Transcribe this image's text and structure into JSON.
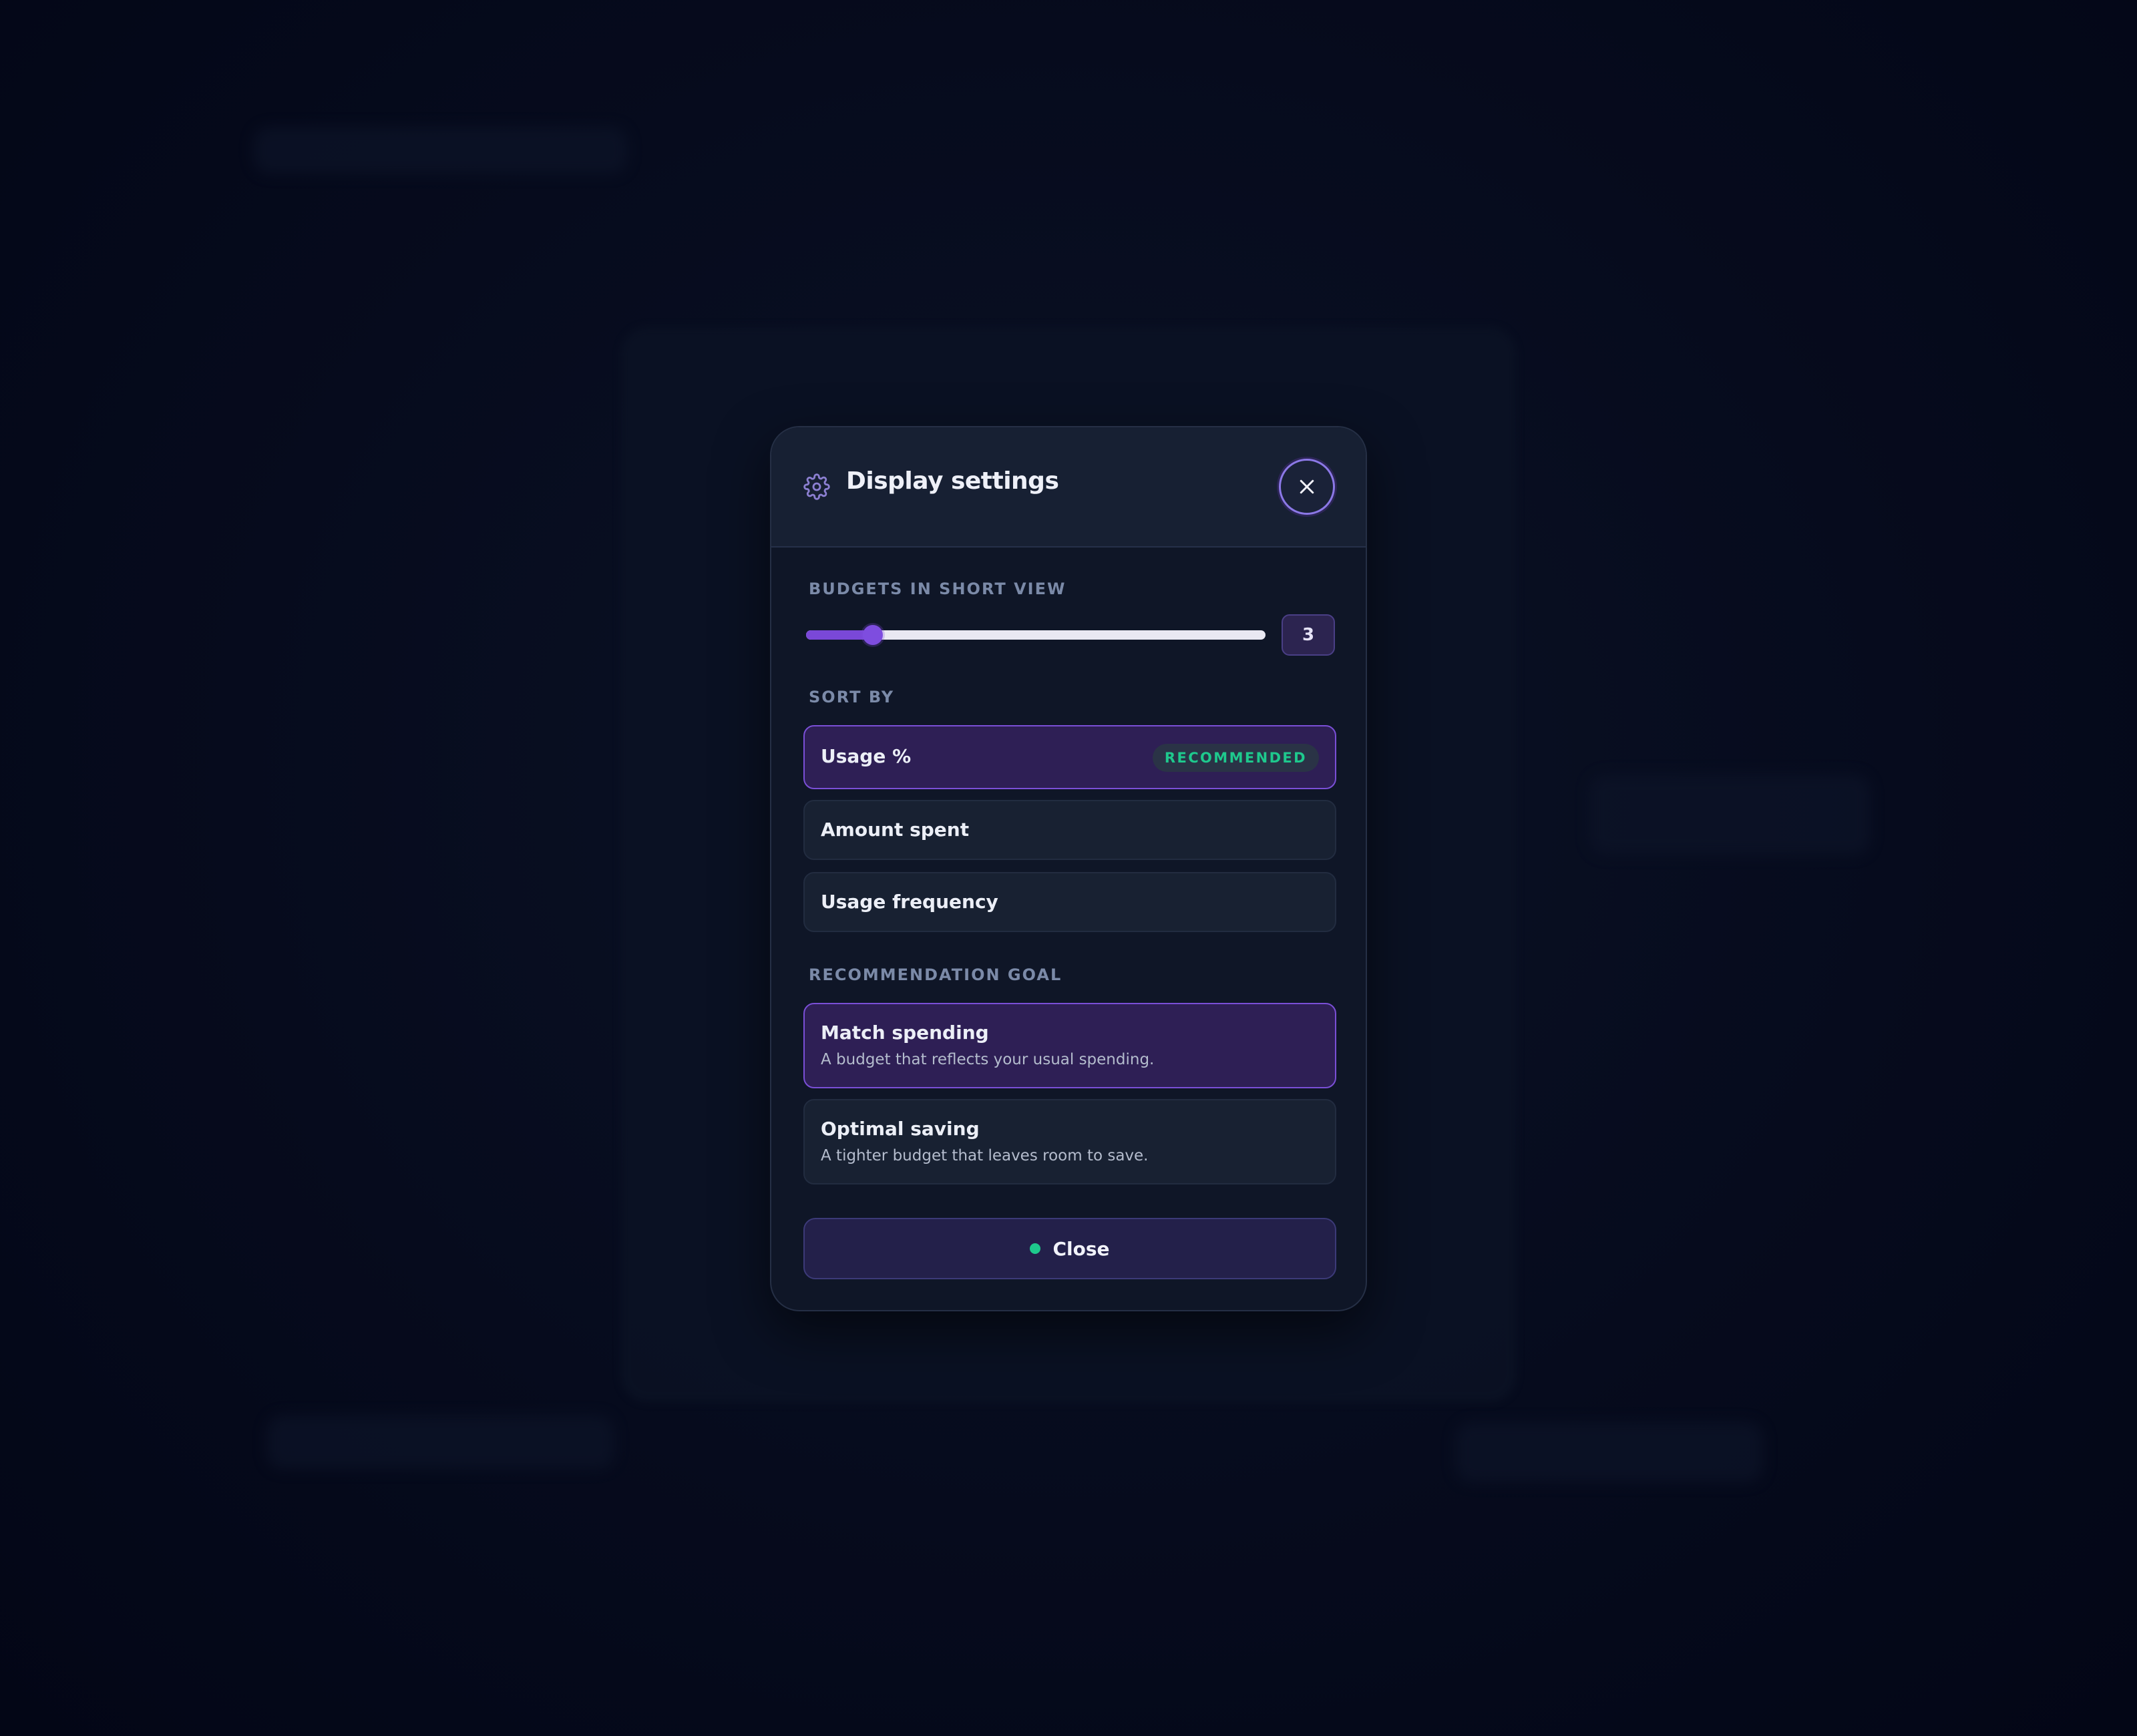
{
  "modal": {
    "title": "Display settings",
    "icon": "gear-icon",
    "close_icon": "close-icon"
  },
  "budgets_short_view": {
    "label": "BUDGETS IN SHORT VIEW",
    "value": "3",
    "slider_fraction": 0.145
  },
  "sort_by": {
    "label": "SORT BY",
    "options": [
      {
        "label": "Usage %",
        "badge": "RECOMMENDED",
        "selected": true
      },
      {
        "label": "Amount spent",
        "selected": false
      },
      {
        "label": "Usage frequency",
        "selected": false
      }
    ]
  },
  "recommendation_goal": {
    "label": "RECOMMENDATION GOAL",
    "options": [
      {
        "label": "Match spending",
        "description": "A budget that reflects your usual spending.",
        "selected": true
      },
      {
        "label": "Optimal saving",
        "description": "A tighter budget that leaves room to save.",
        "selected": false
      }
    ]
  },
  "footer": {
    "close_label": "Close"
  },
  "colors": {
    "accent": "#7a48d8",
    "success": "#1ec98d",
    "background": "#040818",
    "panel": "#0f1627"
  }
}
